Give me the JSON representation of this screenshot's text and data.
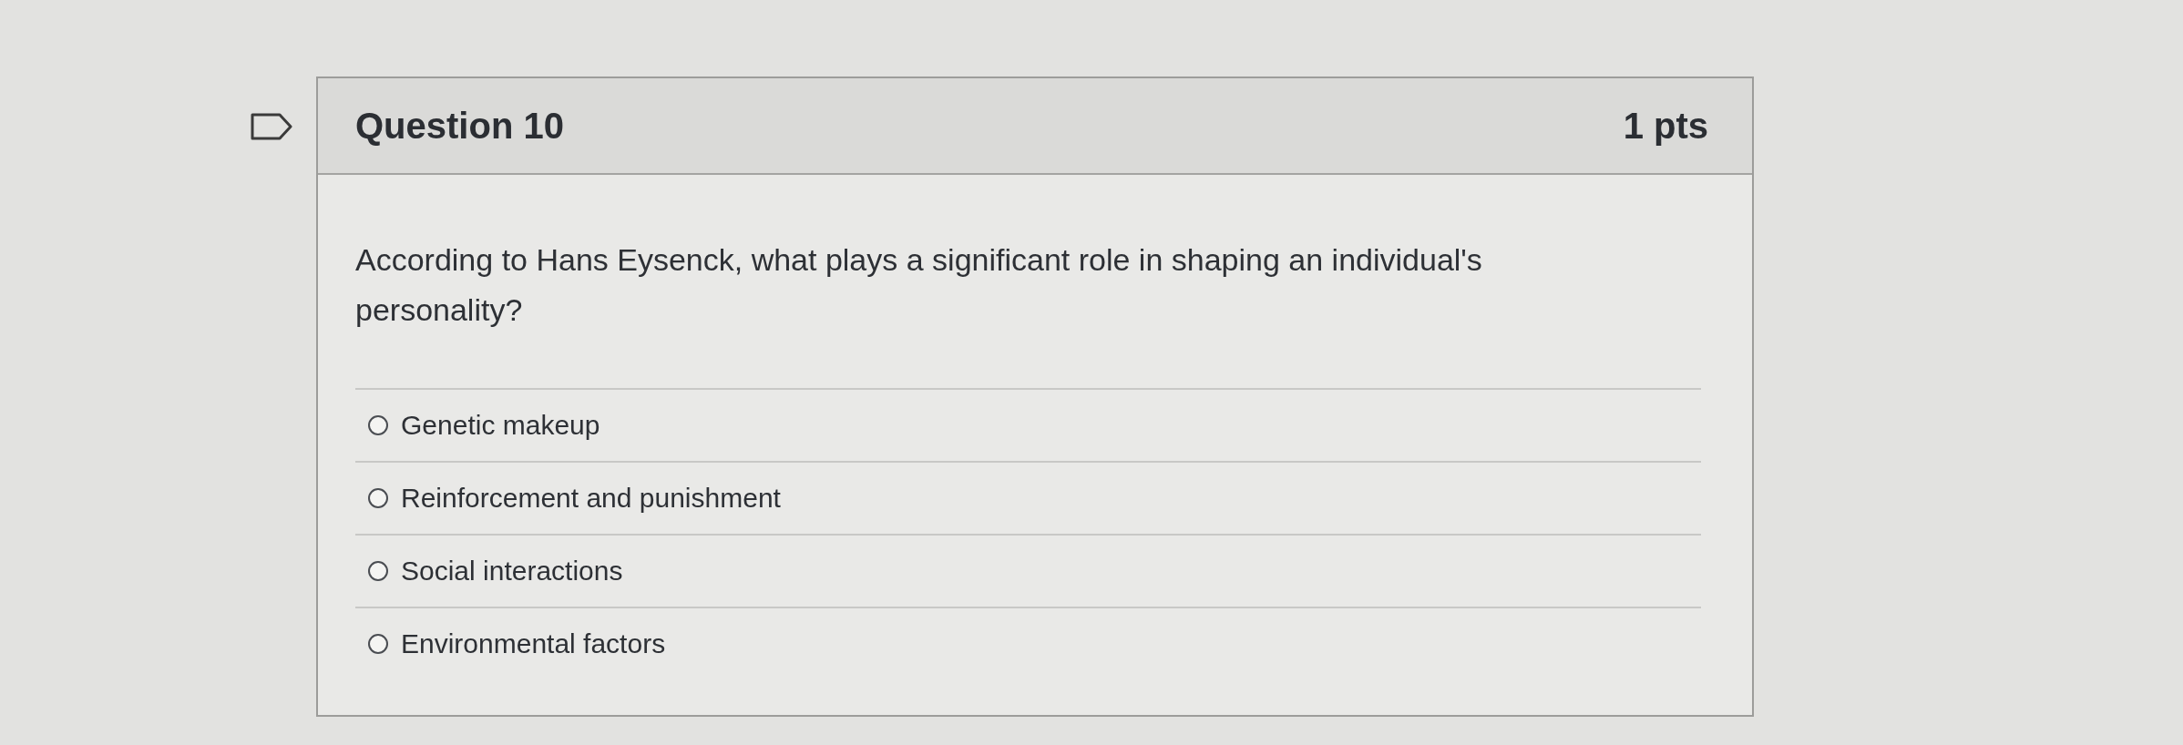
{
  "question": {
    "flagged": false,
    "title": "Question 10",
    "points": "1 pts",
    "text": "According to Hans Eysenck, what plays a significant role in shaping an individual's personality?"
  },
  "answers": [
    {
      "label": "Genetic makeup",
      "selected": false
    },
    {
      "label": "Reinforcement and punishment",
      "selected": false
    },
    {
      "label": "Social interactions",
      "selected": false
    },
    {
      "label": "Environmental factors",
      "selected": false
    }
  ]
}
